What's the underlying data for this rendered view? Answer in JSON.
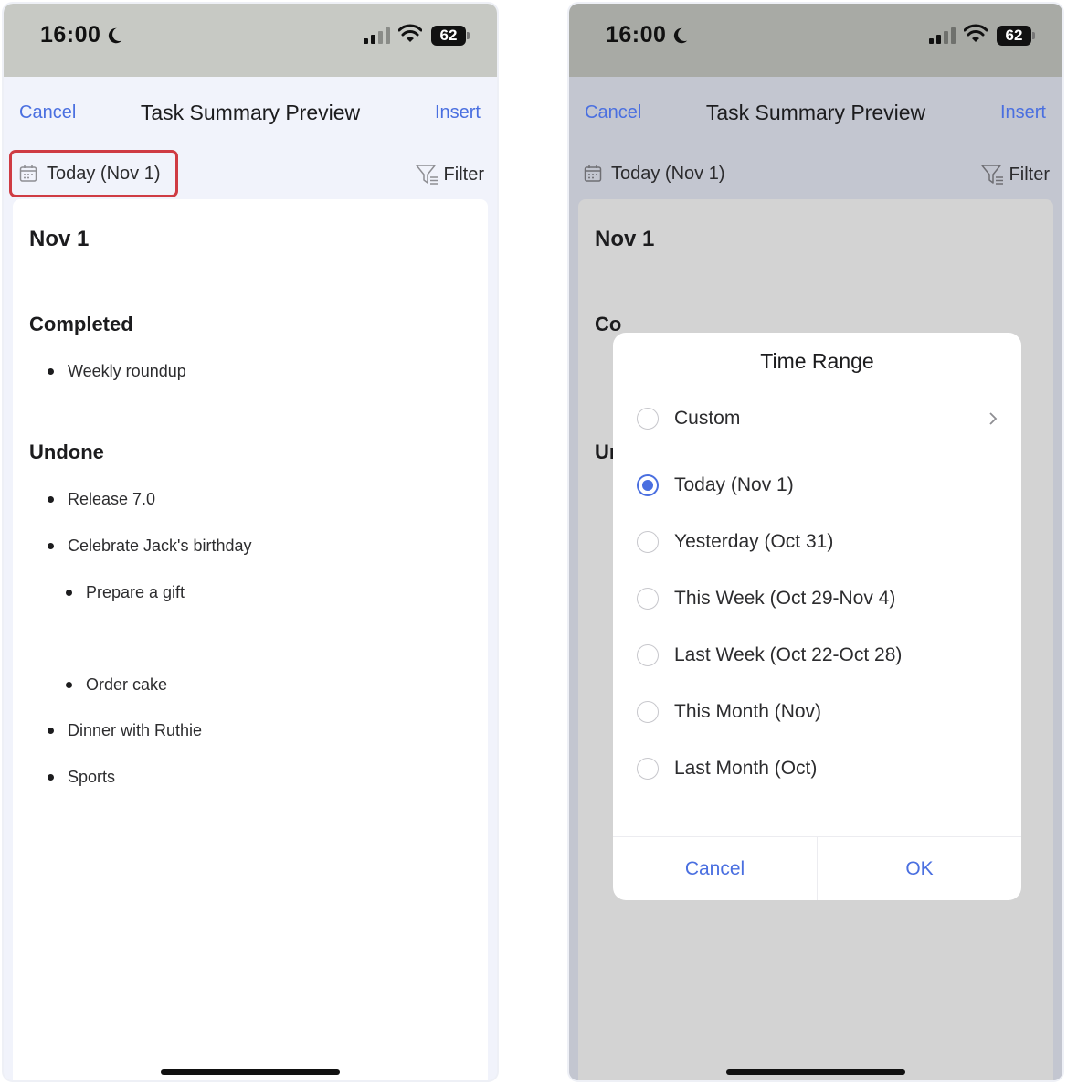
{
  "status_bar": {
    "time": "16:00",
    "battery": "62"
  },
  "nav": {
    "cancel": "Cancel",
    "title": "Task Summary Preview",
    "insert": "Insert"
  },
  "toolbar": {
    "date_range": "Today (Nov 1)",
    "filter": "Filter"
  },
  "summary": {
    "date": "Nov 1",
    "completed_heading": "Completed",
    "completed": [
      "Weekly roundup"
    ],
    "undone_heading": "Undone",
    "undone": [
      "Release 7.0",
      "Celebrate Jack's birthday",
      "Dinner with Ruthie",
      "Sports"
    ],
    "subtasks": [
      "Prepare a gift",
      "Order cake"
    ]
  },
  "right_summary": {
    "heading_partial_1": "Co",
    "heading_partial_2": "Ur"
  },
  "dialog": {
    "title": "Time Range",
    "options": [
      "Custom",
      "Today (Nov 1)",
      "Yesterday (Oct 31)",
      "This Week (Oct 29-Nov 4)",
      "Last Week (Oct 22-Oct 28)",
      "This Month (Nov)",
      "Last Month (Oct)"
    ],
    "selected_option": "Today (Nov 1)",
    "cancel": "Cancel",
    "ok": "OK"
  },
  "colors": {
    "accent": "#4a6fe0",
    "highlight_border": "#cf3b43"
  }
}
